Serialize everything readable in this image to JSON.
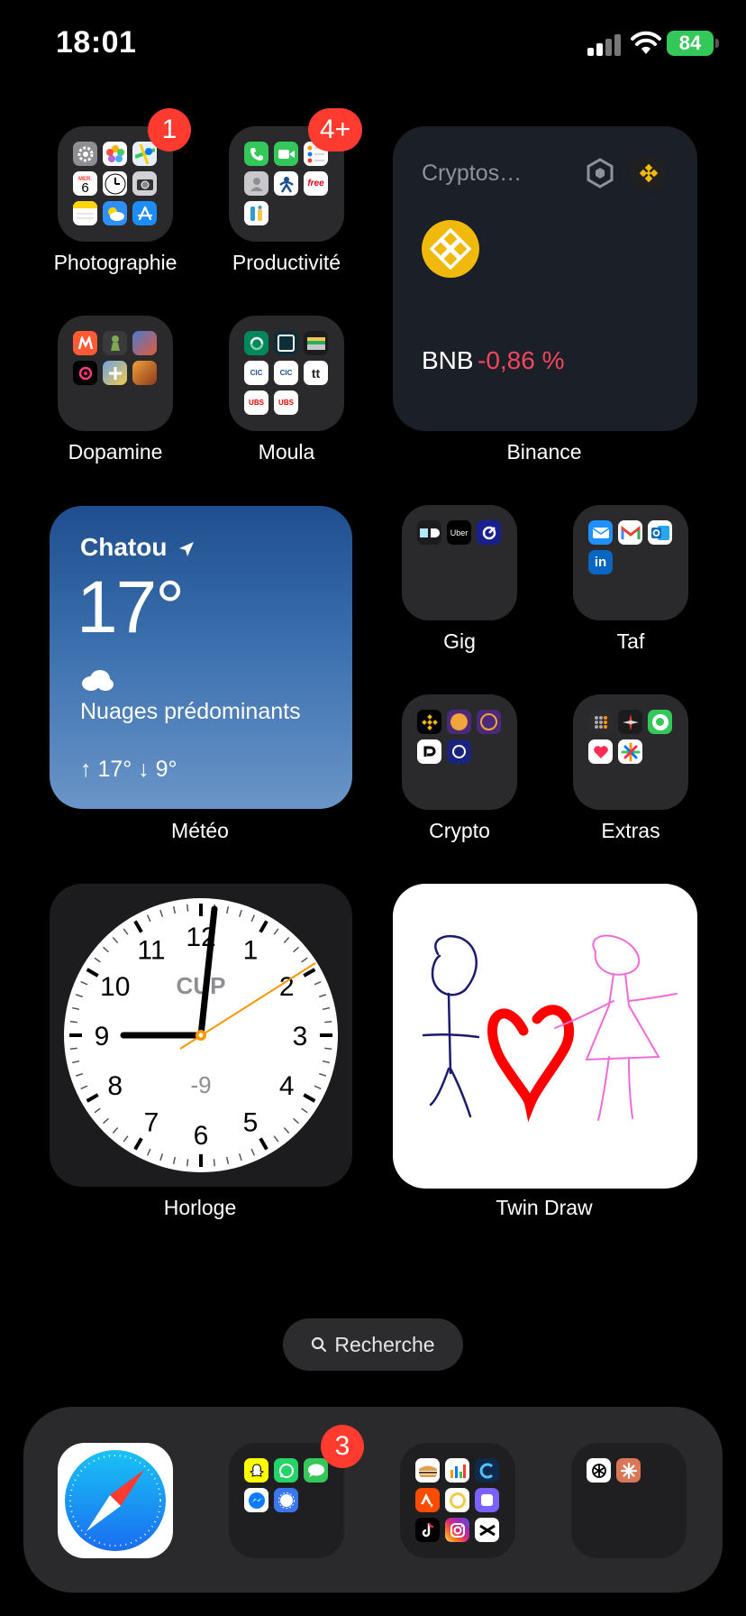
{
  "status_bar": {
    "time": "18:01",
    "battery": "84"
  },
  "folders": {
    "photographie": {
      "label": "Photographie",
      "badge": "1",
      "calendar_day": "6",
      "calendar_month": "MER."
    },
    "productivite": {
      "label": "Productivité",
      "badge": "4+",
      "free_text": "free"
    },
    "dopamine": {
      "label": "Dopamine"
    },
    "moula": {
      "label": "Moula",
      "ubs1": "UBS",
      "ubs2": "UBS",
      "tt": "tt",
      "cic1": "CIC",
      "cic2": "CIC"
    },
    "gig": {
      "label": "Gig",
      "uber": "Uber"
    },
    "taf": {
      "label": "Taf",
      "linkedin": "in"
    },
    "crypto": {
      "label": "Crypto"
    },
    "extras": {
      "label": "Extras"
    }
  },
  "binance_widget": {
    "title": "Cryptos…",
    "coin": "BNB",
    "change": "-0,86 %",
    "label": "Binance"
  },
  "weather_widget": {
    "city": "Chatou",
    "temperature": "17°",
    "condition": "Nuages prédominants",
    "range": "↑ 17° ↓ 9°",
    "label": "Météo"
  },
  "clock_widget": {
    "city_code": "CUP",
    "offset": "-9",
    "numbers": [
      "12",
      "1",
      "2",
      "3",
      "4",
      "5",
      "6",
      "7",
      "8",
      "9",
      "10",
      "11"
    ],
    "label": "Horloge"
  },
  "twin_draw_widget": {
    "label": "Twin Draw"
  },
  "search": {
    "label": "Recherche"
  },
  "dock": {
    "folder2_badge": "3"
  },
  "colors": {
    "badge": "#ff3b30",
    "battery": "#34c759",
    "bnb_yellow": "#f0b90b",
    "negative": "#f6465d"
  }
}
